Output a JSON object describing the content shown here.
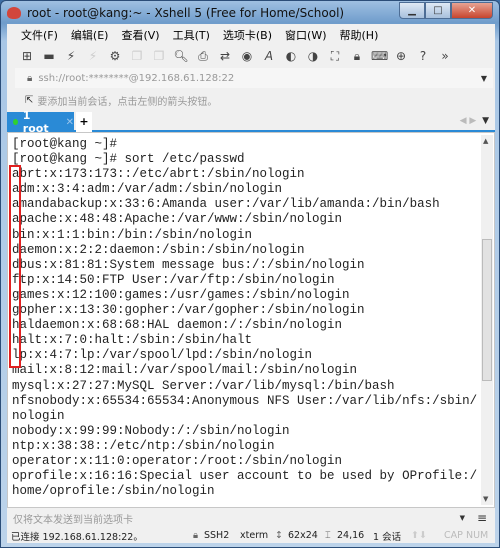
{
  "window": {
    "title": "root - root@kang:~ - Xshell 5 (Free for Home/School)"
  },
  "menu": [
    "文件(F)",
    "编辑(E)",
    "查看(V)",
    "工具(T)",
    "选项卡(B)",
    "窗口(W)",
    "帮助(H)"
  ],
  "toolbar": {
    "icons": [
      "new-session-icon",
      "open-folder-icon",
      "connect-icon",
      "disconnect-icon",
      "properties-icon",
      "copy-icon",
      "paste-icon",
      "find-icon",
      "print-icon",
      "transfer-icon",
      "globe-icon",
      "font-icon",
      "xftp-icon",
      "xmanager-icon",
      "fullscreen-icon",
      "lock-icon",
      "keyboard-icon",
      "new-tab-icon",
      "help-icon",
      "more-icon"
    ]
  },
  "address": {
    "value": "ssh://root:********@192.168.61.128:22"
  },
  "hint": {
    "text": "要添加当前会话，点击左侧的箭头按钮。"
  },
  "tabs": [
    {
      "label": "1 root",
      "active": true,
      "status_color": "#2fd12f"
    }
  ],
  "terminal": {
    "lines": [
      "[root@kang ~]#",
      "[root@kang ~]# sort /etc/passwd",
      "abrt:x:173:173::/etc/abrt:/sbin/nologin",
      "adm:x:3:4:adm:/var/adm:/sbin/nologin",
      "amandabackup:x:33:6:Amanda user:/var/lib/amanda:/bin/bash",
      "apache:x:48:48:Apache:/var/www:/sbin/nologin",
      "bin:x:1:1:bin:/bin:/sbin/nologin",
      "daemon:x:2:2:daemon:/sbin:/sbin/nologin",
      "dbus:x:81:81:System message bus:/:/sbin/nologin",
      "ftp:x:14:50:FTP User:/var/ftp:/sbin/nologin",
      "games:x:12:100:games:/usr/games:/sbin/nologin",
      "gopher:x:13:30:gopher:/var/gopher:/sbin/nologin",
      "haldaemon:x:68:68:HAL daemon:/:/sbin/nologin",
      "halt:x:7:0:halt:/sbin:/sbin/halt",
      "lp:x:4:7:lp:/var/spool/lpd:/sbin/nologin",
      "mail:x:8:12:mail:/var/spool/mail:/sbin/nologin",
      "mysql:x:27:27:MySQL Server:/var/lib/mysql:/bin/bash",
      "nfsnobody:x:65534:65534:Anonymous NFS User:/var/lib/nfs:/sbin/",
      "nologin",
      "nobody:x:99:99:Nobody:/:/sbin/nologin",
      "ntp:x:38:38::/etc/ntp:/sbin/nologin",
      "operator:x:11:0:operator:/root:/sbin/nologin",
      "oprofile:x:16:16:Special user account to be used by OProfile:/",
      "home/oprofile:/sbin/nologin"
    ],
    "highlight_color": "#e02020"
  },
  "send_bar": {
    "placeholder": "仅将文本发送到当前选项卡"
  },
  "status": {
    "connection": "已连接 192.168.61.128:22。",
    "protocol": "SSH2",
    "term": "xterm",
    "size": "62x24",
    "cursor": "24,16",
    "sessions": "1 会话",
    "caps": "CAP",
    "num": "NUM"
  }
}
